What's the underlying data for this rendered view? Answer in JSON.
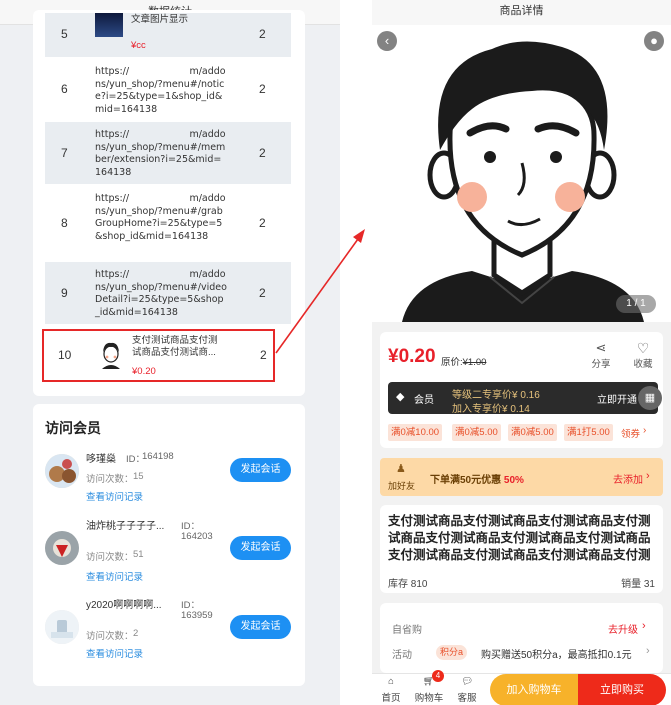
{
  "left_panel": {
    "title": "数据统计",
    "rows": [
      {
        "num": "5",
        "text": "文章图片显示",
        "price": "¥cc",
        "count": "2"
      },
      {
        "num": "6",
        "url": "https://                    m/addons/yun_shop/?menu#/notice?i=25&type=1&shop_id&mid=164138",
        "count": "2"
      },
      {
        "num": "7",
        "url": "https://                    m/addons/yun_shop/?menu#/member/extension?i=25&mid=164138",
        "count": "2"
      },
      {
        "num": "8",
        "url": "https://                    m/addons/yun_shop/?menu#/grabGroupHome?i=25&type=5&shop_id&mid=164138",
        "count": "2"
      },
      {
        "num": "9",
        "url": "https://                    m/addons/yun_shop/?menu#/videoDetail?i=25&type=5&shop_id&mid=164138",
        "count": "2"
      },
      {
        "num": "10",
        "text": "支付测试商品支付测试商品支付测试商...",
        "price": "¥0.20",
        "count": "2"
      }
    ],
    "visit_title": "访问会员",
    "members": [
      {
        "name": "哆瑾燊",
        "id_label": "ID：",
        "id": "164198",
        "visits_label": "访问次数：",
        "visits": "15",
        "record": "查看访问记录",
        "chat": "发起会话"
      },
      {
        "name": "油炸桃子子子子...",
        "id_label": "ID：",
        "id": "164203",
        "visits_label": "访问次数：",
        "visits": "51",
        "record": "查看访问记录",
        "chat": "发起会话"
      },
      {
        "name": "y2020啊啊啊啊...",
        "id_label": "ID：",
        "id": "163959",
        "visits_label": "访问次数：",
        "visits": "2",
        "record": "查看访问记录",
        "chat": "发起会话"
      }
    ]
  },
  "right_panel": {
    "title": "商品详情",
    "pager": "1 / 1",
    "price": "¥0.20",
    "orig_label": "原价:",
    "orig_price": "¥1.00",
    "share": "分享",
    "favorite": "收藏",
    "vip_label": "会员",
    "vip_level1": "等级二专享价¥ 0.16",
    "vip_level2": "加入专享价¥ 0.14",
    "vip_open": "立即开通",
    "coupons": [
      "满0减10.00",
      "满0减5.00",
      "满0减5.00",
      "满1打5.00"
    ],
    "coupon_more": "领券",
    "promo_tag": "加好友",
    "promo_text": "下单满50元优惠",
    "promo_pct": "50%",
    "promo_add": "去添加",
    "product_name": "支付测试商品支付测试商品支付测试商品支付测试商品支付测试商品支付测试商品支付测试商品支付测试商品支付测试商品支付测试商品支付测试商品...",
    "stock_label": "库存 810",
    "sales_label": "销量 31",
    "self_buy": "自省购",
    "upgrade": "去升级",
    "activity": "活动",
    "points_tag": "积分a",
    "activity_text": "购买赠送50积分a，最高抵扣0.1元",
    "nav_home": "首页",
    "nav_cart": "购物车",
    "cart_badge": "4",
    "nav_service": "客服",
    "add_cart": "加入购物车",
    "buy_now": "立即购买"
  }
}
